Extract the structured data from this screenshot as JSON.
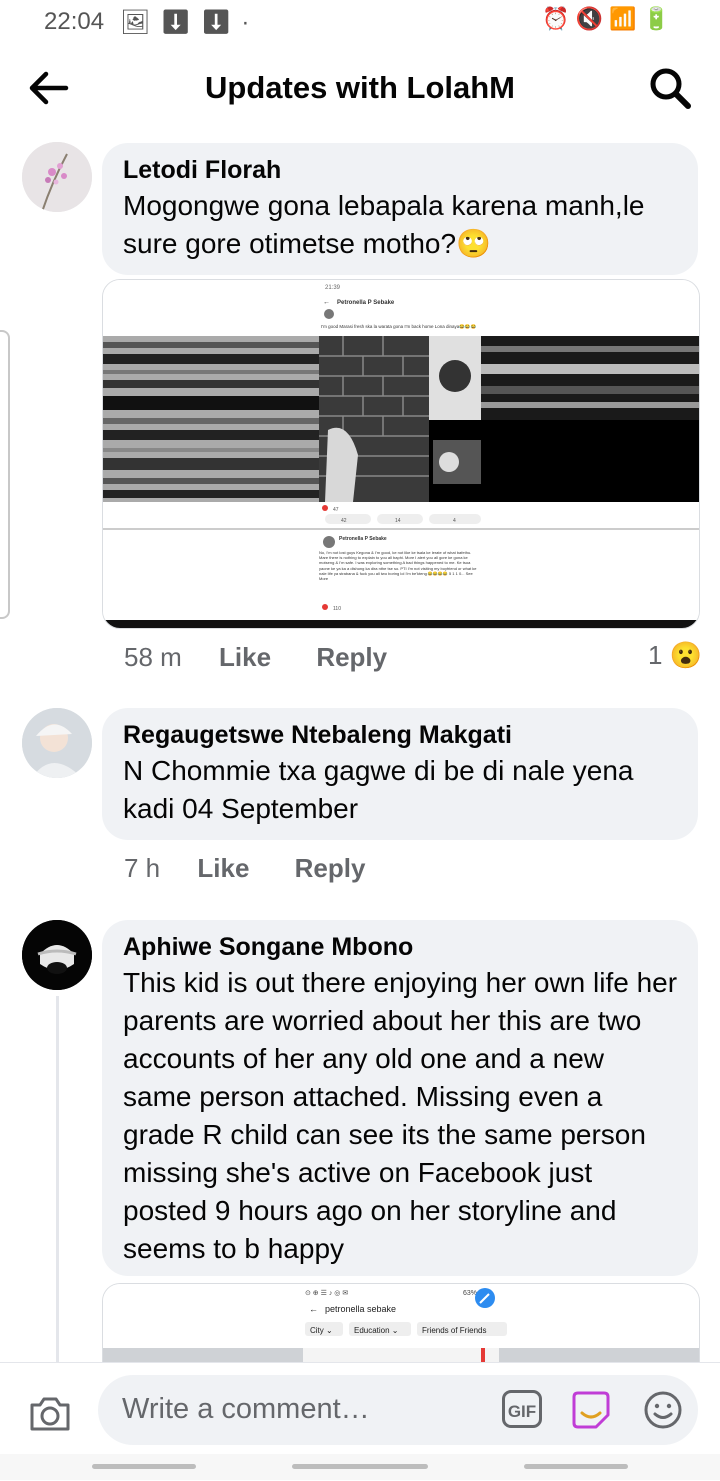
{
  "status_bar": {
    "time": "22:04"
  },
  "header": {
    "title": "Updates with LolahM"
  },
  "comments": [
    {
      "author": "Letodi Florah",
      "text": "Mogongwe gona lebapala karena manh,le sure gore otimetse motho?🙄",
      "time": "58 m",
      "like": "Like",
      "reply": "Reply",
      "reaction_count": "1",
      "reaction_emoji": "😮"
    },
    {
      "author": "Regaugetswe Ntebaleng Makgati",
      "text": "N Chommie txa gagwe di be di nale yena kadi 04 September",
      "time": "7 h",
      "like": "Like",
      "reply": "Reply"
    },
    {
      "author": "Aphiwe Songane Mbono",
      "text": "This kid is out there enjoying her own life her parents are worried about her this are two accounts of her any old one and a new same person attached. Missing even a grade R child can see its the same person missing she's active on Facebook just posted 9 hours ago on her storyline and seems to b happy"
    }
  ],
  "attachment1": {
    "status_time": "21:39",
    "profile_name": "Petronella P Sebake",
    "post_text": "I'm good Marasi fresh ska la warata gona I'm back home Lona dinaya😂😂😂",
    "reaction_count": "47",
    "likes": "42",
    "comments": "14",
    "shares": "4",
    "post2_name": "Petronella P Sebake",
    "post2_text": "No, I'm not lost guys Kegona & I'm good, ke not like ke tsala ke lerate of what bafethu. Mare there is nothing to explain to you all baphi. More I alert you all gore ke gona ke motseng & I'm safe. I was exploring something A bad things happened to me. Ke tsoa yaone ke ya ka a dishong ka dira nthe tse so. PTI I'm not visiting my boyfriend or what ke nale life ya strabana & fuck you all two boring lol I'm be'kteng 😂😂😂😂 5 1 1 0... See More",
    "post2_reactions": "110"
  },
  "attachment2": {
    "status": "63%",
    "profile_name": "petronella sebake",
    "chips": [
      "City ⌄",
      "Education ⌄",
      "Friends of Friends"
    ]
  },
  "composer": {
    "placeholder": "Write a comment…",
    "gif_label": "GIF"
  },
  "colors": {
    "bubble": "#f0f2f5",
    "meta": "#65676b",
    "sticker_accent": "#c03dd6"
  }
}
